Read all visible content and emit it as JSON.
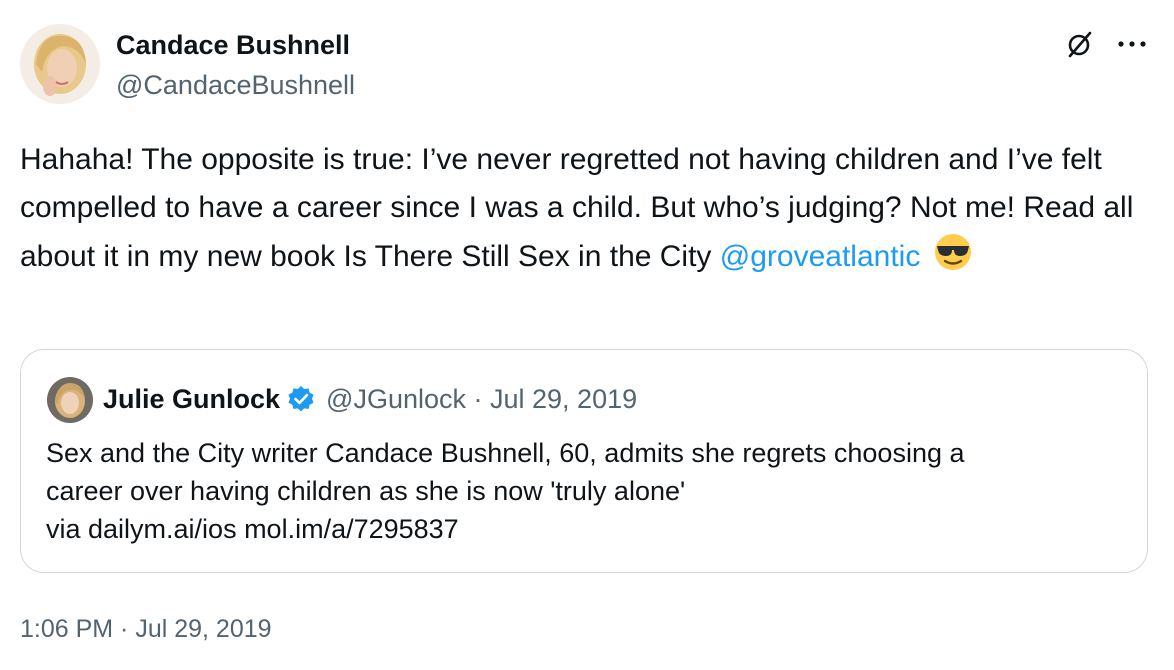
{
  "author": {
    "name": "Candace Bushnell",
    "handle": "@CandaceBushnell"
  },
  "tweet": {
    "text_before_mention": "Hahaha! The opposite is true: I’ve never regretted not having children and I’ve felt compelled to have a career since I was a child. But who’s judging? Not me! Read all about it in my new book Is There Still Sex in the City ",
    "mention": "@groveatlantic",
    "emoji": "sunglasses-face"
  },
  "quoted_tweet": {
    "name": "Julie Gunlock",
    "verified": true,
    "handle_date": "@JGunlock · Jul 29, 2019",
    "line1": "Sex and the City writer Candace Bushnell, 60, admits she regrets choosing a",
    "line2": "career over having children as she is now 'truly alone'",
    "line3": "via dailym.ai/ios mol.im/a/7295837"
  },
  "timestamp": "1:06 PM · Jul 29, 2019",
  "colors": {
    "link": "#1d9bf0",
    "secondary_text": "#536471",
    "border": "#cfd9de",
    "verified_badge": "#1d9bf0"
  },
  "icons": [
    "grok-icon",
    "more-options-icon",
    "verified-badge-icon"
  ]
}
